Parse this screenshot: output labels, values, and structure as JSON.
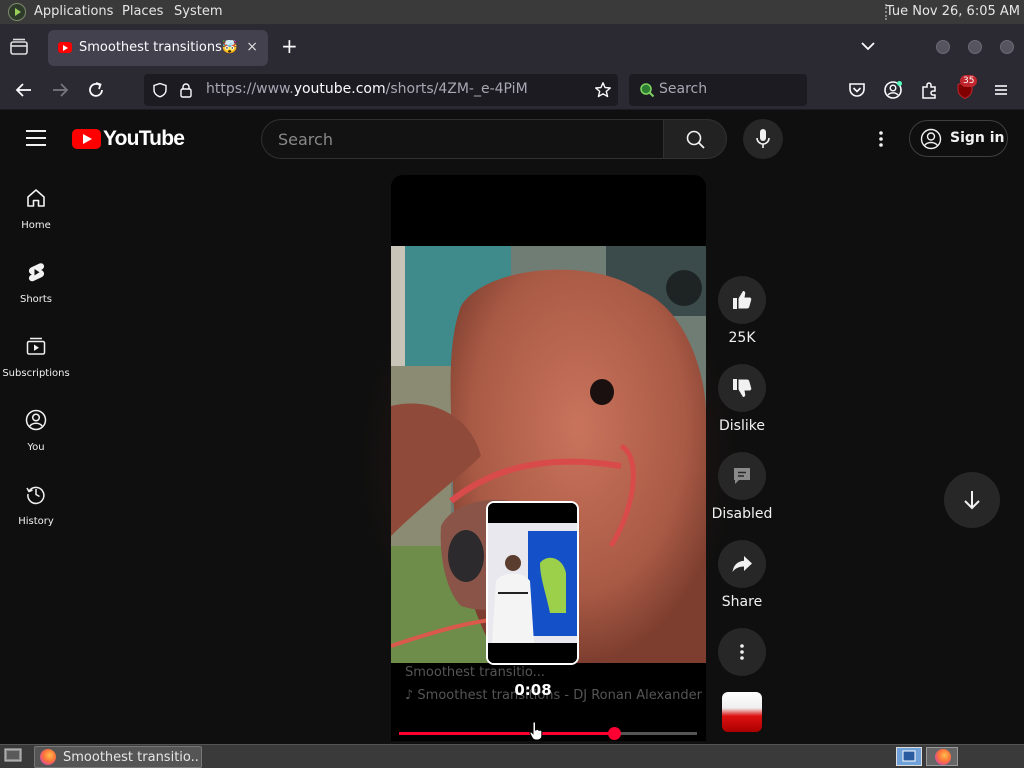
{
  "os_panel": {
    "menus": [
      "Applications",
      "Places",
      "System"
    ],
    "clock": "Tue Nov 26,  6:05 AM"
  },
  "browser": {
    "tab": {
      "title": "Smoothest transitions🤯 - YouTube",
      "close_icon": "×"
    },
    "new_tab_icon": "+",
    "url": {
      "prefix": "https://www.",
      "domain": "youtube.com",
      "path": "/shorts/4ZM-_e-4PiM"
    },
    "search_placeholder": "Search",
    "extension_badge": "35"
  },
  "youtube": {
    "logo_text": "YouTube",
    "search_placeholder": "Search",
    "sign_in_label": "Sign in",
    "guide": [
      {
        "label": "Home",
        "icon": "home-icon"
      },
      {
        "label": "Shorts",
        "icon": "shorts-icon"
      },
      {
        "label": "Subscriptions",
        "icon": "subscriptions-icon"
      },
      {
        "label": "You",
        "icon": "you-icon"
      },
      {
        "label": "History",
        "icon": "history-icon"
      }
    ],
    "player": {
      "overlay_line1": "Smoothest transitio...",
      "overlay_line2": "♪ Smoothest transitions - DJ Ronan Alexander",
      "seek_time": "0:08",
      "progress": 0.72,
      "hover_position": 0.44,
      "accent_color": "#ff0033"
    },
    "actions": {
      "like_count": "25K",
      "dislike_label": "Dislike",
      "comments_label": "Disabled",
      "share_label": "Share"
    }
  },
  "taskbar": {
    "window_title": "Smoothest transitio..."
  }
}
